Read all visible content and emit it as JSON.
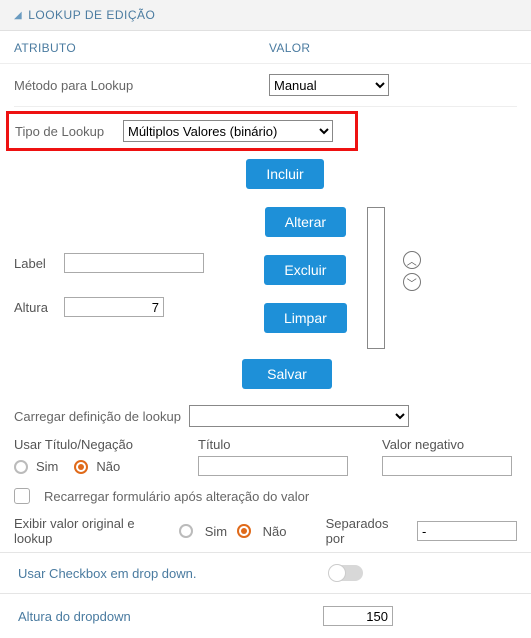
{
  "header": {
    "title": "LOOKUP DE EDIÇÃO"
  },
  "columns": {
    "attribute": "ATRIBUTO",
    "value": "VALOR"
  },
  "rows": {
    "lookup_method_label": "Método para Lookup",
    "lookup_method_value": "Manual",
    "lookup_type_label": "Tipo de Lookup",
    "lookup_type_value": "Múltiplos Valores (binário)"
  },
  "buttons": {
    "include": "Incluir",
    "alter": "Alterar",
    "exclude": "Excluir",
    "clear": "Limpar",
    "save": "Salvar"
  },
  "labels": {
    "label": "Label",
    "height_label": "Altura",
    "height_value": "7",
    "load_def": "Carregar definição de lookup",
    "use_title_neg": "Usar Título/Negação",
    "title": "Título",
    "neg_value": "Valor negativo",
    "yes": "Sim",
    "no": "Não",
    "reload_form": "Recarregar formulário após alteração do valor",
    "show_original": "Exibir valor original e lookup",
    "sep_by": "Separados por",
    "sep_value": "-",
    "use_checkbox_dd": "Usar Checkbox em drop down.",
    "dd_height_label": "Altura do dropdown",
    "dd_height_value": "150"
  }
}
